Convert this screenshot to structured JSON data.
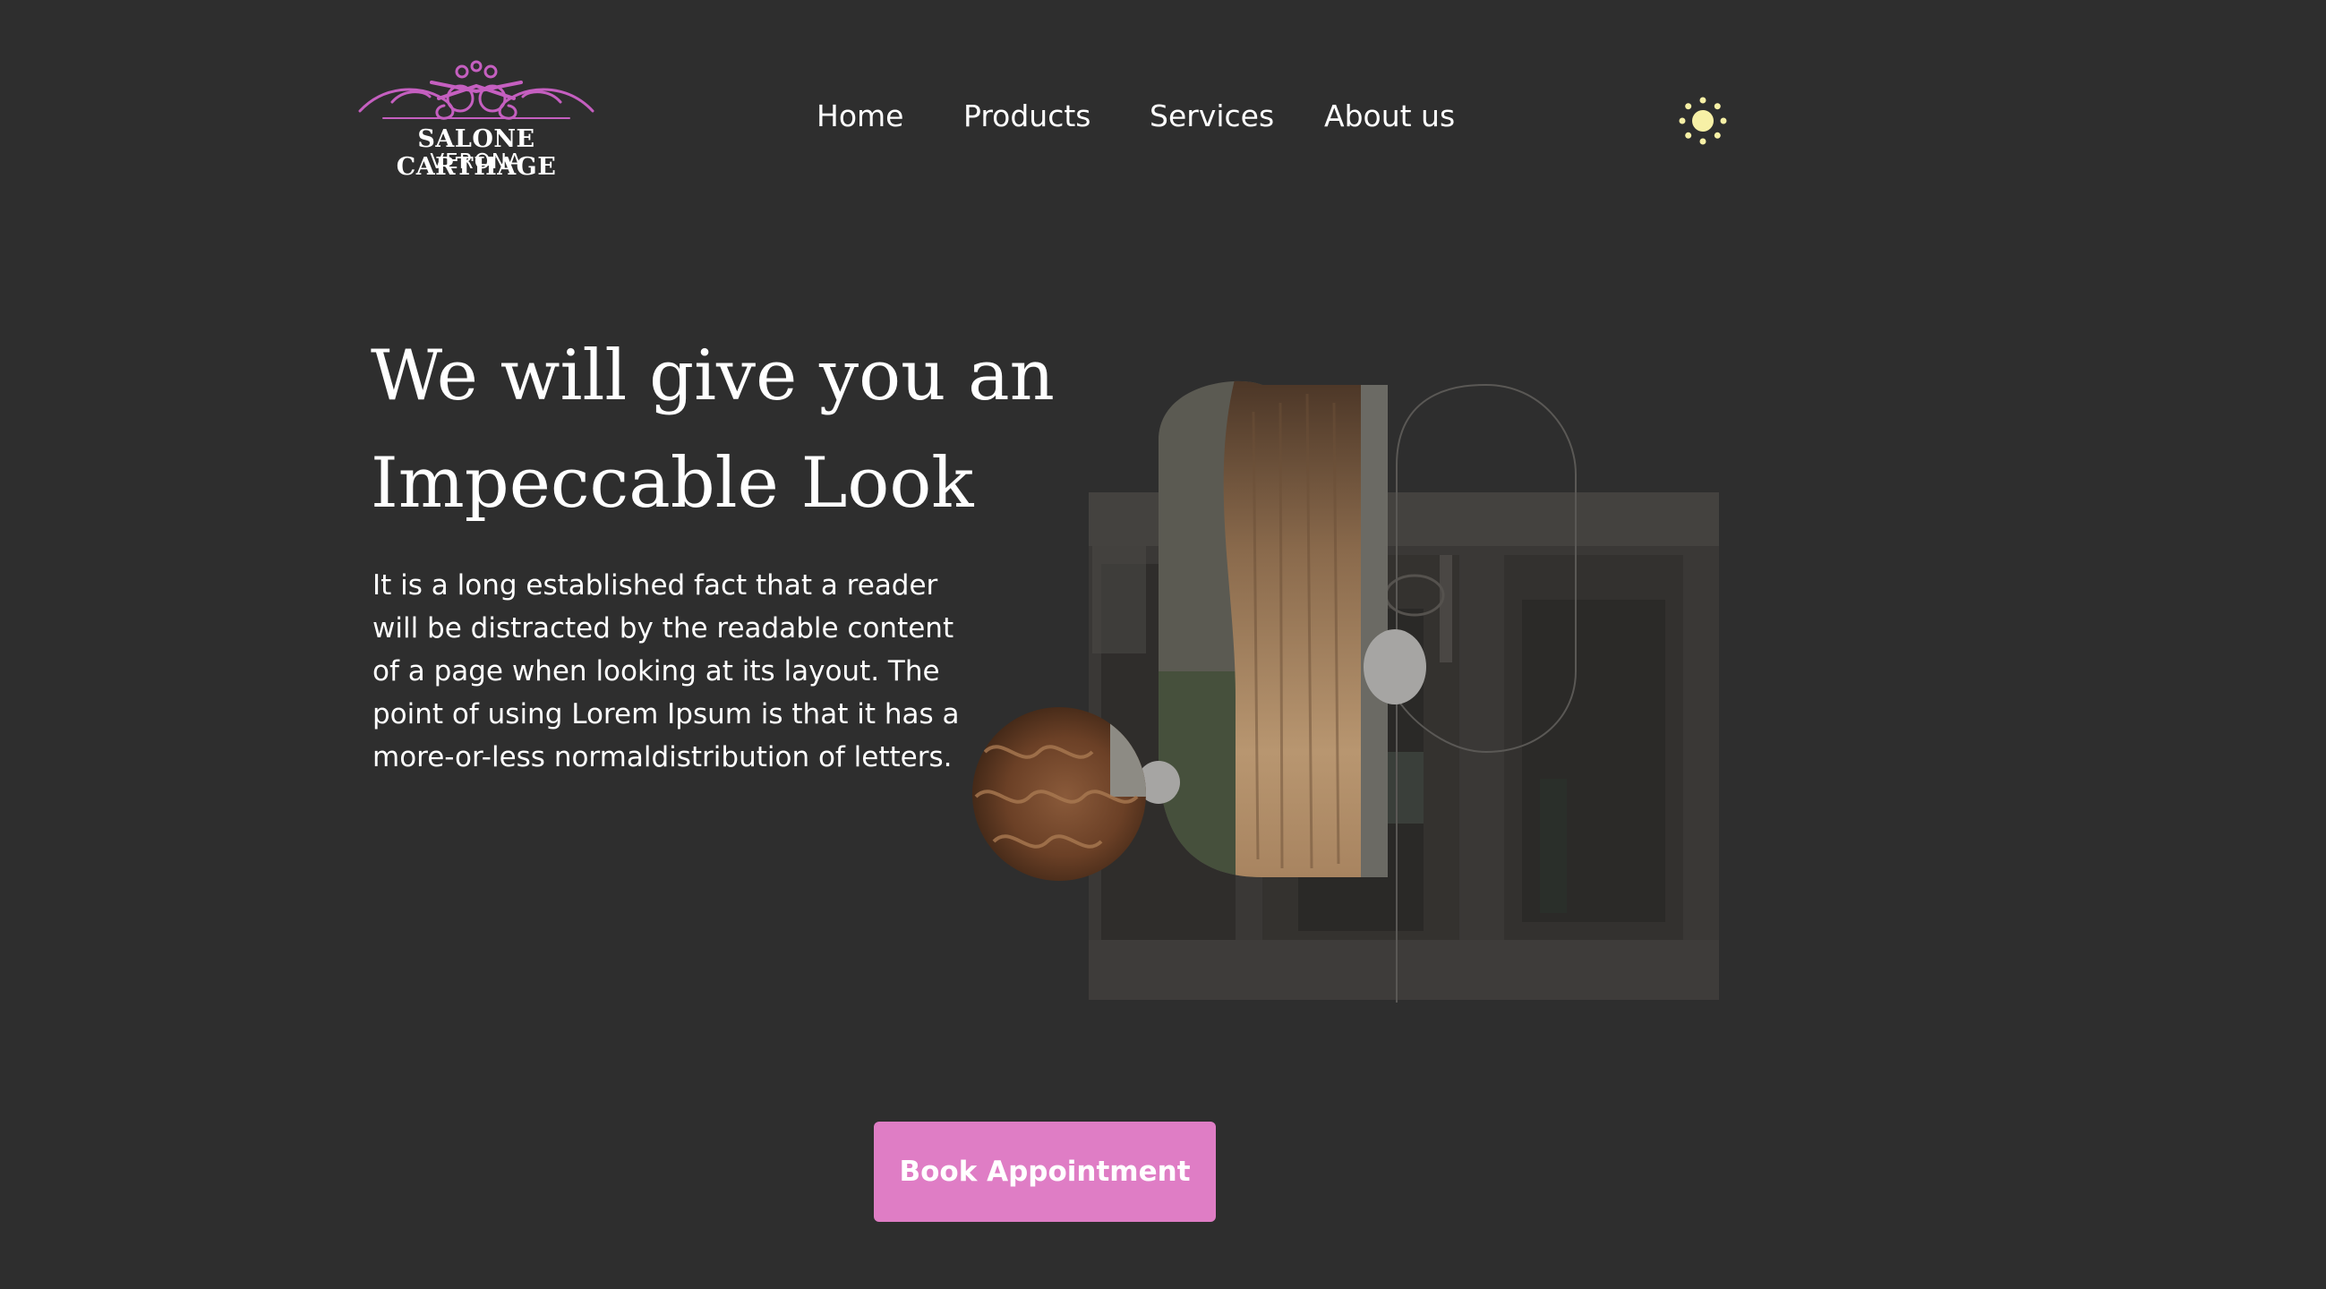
{
  "brand": {
    "name_line1": "SALONE CARTHAGE",
    "name_line2": "VERONA",
    "accent_color": "#c55fc0"
  },
  "nav": {
    "items": [
      {
        "label": "Home"
      },
      {
        "label": "Products"
      },
      {
        "label": "Services"
      },
      {
        "label": "About us"
      }
    ]
  },
  "theme_toggle": {
    "icon": "sun-icon",
    "color": "#f7f0a6"
  },
  "hero": {
    "title_line1": "We will give you an",
    "title_line2": "Impeccable Look",
    "description": "It is a long established fact that a reader will be distracted by the readable content of a page when looking at its layout. The point of using Lorem Ipsum is that it has a more-or-less normaldistribution of letters.",
    "images": {
      "storefront": "salon-storefront-image",
      "straight_hair": "long-straight-hair-image",
      "curly_hair": "curly-hair-image"
    }
  },
  "cta": {
    "label": "Book Appointment",
    "color": "#df7dc5"
  },
  "colors": {
    "background": "#2e2e2e",
    "text": "#ffffff"
  }
}
